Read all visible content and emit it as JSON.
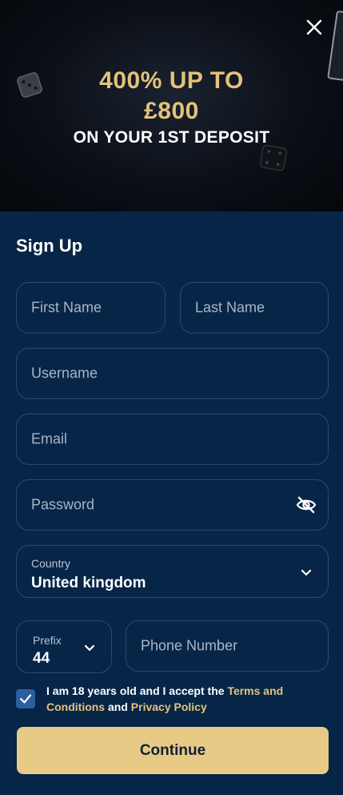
{
  "banner": {
    "line1": "400% UP TO",
    "line2": "£800",
    "line3": "ON YOUR 1ST DEPOSIT",
    "accent_color": "#e3c27a"
  },
  "close": {
    "icon": "close-icon"
  },
  "form": {
    "title": "Sign Up",
    "first_name_placeholder": "First Name",
    "last_name_placeholder": "Last Name",
    "username_placeholder": "Username",
    "email_placeholder": "Email",
    "password_placeholder": "Password",
    "country": {
      "label": "Country",
      "value": "United kingdom"
    },
    "prefix": {
      "label": "Prefix",
      "value": "44"
    },
    "phone_placeholder": "Phone Number",
    "consent": {
      "checked": true,
      "text_before": "I am 18 years old and I accept the ",
      "terms_link": "Terms and Conditions",
      "text_middle": " and ",
      "privacy_link": "Privacy Policy"
    },
    "continue_label": "Continue"
  },
  "colors": {
    "background": "#062547",
    "field_border": "#2b4a6e",
    "button": "#e6ca86",
    "checkbox": "#2b5ea1"
  }
}
